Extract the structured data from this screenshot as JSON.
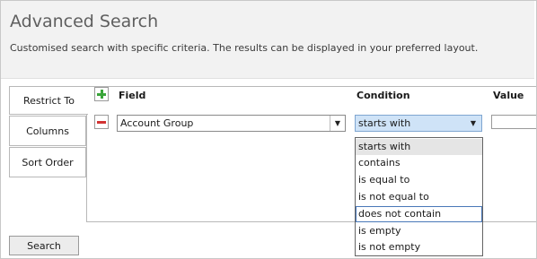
{
  "header": {
    "title": "Advanced Search",
    "subtitle": "Customised search with specific criteria.  The results can be displayed in your preferred layout."
  },
  "tabs": [
    {
      "label": "Restrict To",
      "active": true
    },
    {
      "label": "Columns",
      "active": false
    },
    {
      "label": "Sort Order",
      "active": false
    }
  ],
  "columns": {
    "field": "Field",
    "condition": "Condition",
    "value": "Value"
  },
  "row": {
    "field_value": "Account Group",
    "condition_value": "starts with",
    "value_input": ""
  },
  "condition_options": [
    "starts with",
    "contains",
    "is equal to",
    "is not equal to",
    "does not contain",
    "is empty",
    "is not empty"
  ],
  "icons": {
    "add": "plus-icon",
    "remove": "minus-icon",
    "dropdown": "chevron-down-icon"
  },
  "colors": {
    "add_green": "#3aa53a",
    "remove_red": "#d23333",
    "selected_blue": "#cfe3f7",
    "focus_border": "#4a78b8"
  },
  "footer": {
    "search_label": "Search"
  }
}
